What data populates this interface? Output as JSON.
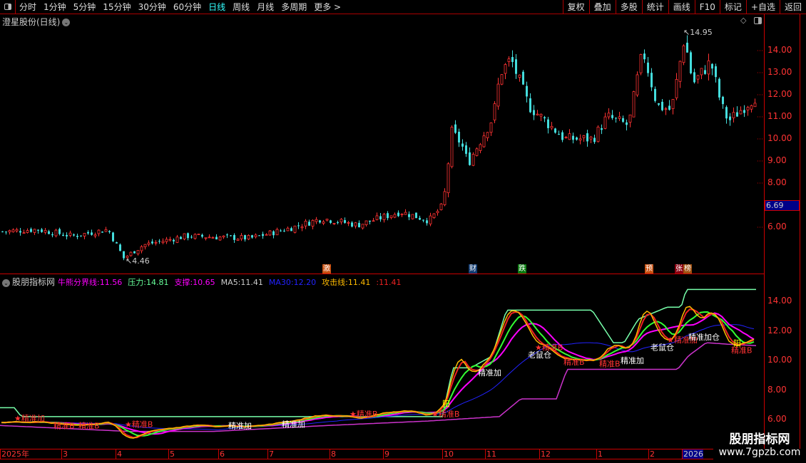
{
  "toolbar": {
    "tabs": [
      "分时",
      "1分钟",
      "5分钟",
      "15分钟",
      "30分钟",
      "60分钟",
      "日线",
      "周线",
      "月线",
      "多周期",
      "更多 >"
    ],
    "active": 6,
    "right": [
      "复权",
      "叠加",
      "多股",
      "统计",
      "画线",
      "F10",
      "标记",
      "+自选",
      "返回"
    ]
  },
  "main": {
    "title": "澄星股份(日线)",
    "high_label": "14.95",
    "low_label": "4.46",
    "current_price": "6.69",
    "yticks": [
      "14.00",
      "13.00",
      "12.00",
      "11.00",
      "10.00",
      "9.00",
      "8.00",
      "6.00"
    ]
  },
  "news": [
    {
      "t": "激",
      "c": "#c85010"
    },
    {
      "t": "财",
      "c": "#103a70"
    },
    {
      "t": "跌",
      "c": "#0a7a10"
    },
    {
      "t": "预",
      "c": "#c85010"
    },
    {
      "t": "张",
      "c": "#8a0010"
    },
    {
      "t": "榜",
      "c": "#a05010"
    }
  ],
  "indicator": {
    "name": "股朋指标网",
    "items": [
      {
        "label": "牛熊分界线:",
        "value": "11.56",
        "color": "#f0f"
      },
      {
        "label": "压力:",
        "value": "14.81",
        "color": "#6f9"
      },
      {
        "label": "支撑:",
        "value": "10.65",
        "color": "#f0f"
      },
      {
        "label": "MA5:",
        "value": "11.41",
        "color": "#ccc"
      },
      {
        "label": "MA30:",
        "value": "12.20",
        "color": "#22f"
      },
      {
        "label": "攻击线:",
        "value": "11.41",
        "color": "#fb0"
      },
      {
        "label": ":",
        "value": "11.41",
        "color": "#e22"
      }
    ],
    "yticks": [
      "14.00",
      "12.00",
      "10.00",
      "8.00",
      "6.00"
    ]
  },
  "dates": [
    "2025年",
    "3",
    "4",
    "5",
    "6",
    "7",
    "8",
    "9",
    "10",
    "11",
    "12",
    "1",
    "2",
    "2026"
  ],
  "watermark": {
    "title": "股朋指标网",
    "url": "www.7gpzb.com"
  },
  "chart_data": {
    "type": "candlestick",
    "anchors": [
      [
        0,
        5.8
      ],
      [
        50,
        5.9
      ],
      [
        100,
        5.6
      ],
      [
        150,
        5.9
      ],
      [
        172,
        4.6
      ],
      [
        200,
        5.2
      ],
      [
        260,
        5.6
      ],
      [
        350,
        5.5
      ],
      [
        410,
        6.0
      ],
      [
        450,
        6.4
      ],
      [
        500,
        6.1
      ],
      [
        560,
        6.7
      ],
      [
        600,
        6.3
      ],
      [
        620,
        7.0
      ],
      [
        632,
        10.3
      ],
      [
        645,
        9.8
      ],
      [
        655,
        8.9
      ],
      [
        690,
        11.0
      ],
      [
        700,
        13.0
      ],
      [
        715,
        13.6
      ],
      [
        740,
        11.5
      ],
      [
        790,
        10.0
      ],
      [
        830,
        10.0
      ],
      [
        850,
        11.0
      ],
      [
        880,
        10.6
      ],
      [
        890,
        12.4
      ],
      [
        900,
        14.0
      ],
      [
        920,
        11.5
      ],
      [
        940,
        11.3
      ],
      [
        958,
        14.6
      ],
      [
        970,
        12.5
      ],
      [
        995,
        13.5
      ],
      [
        1010,
        11.5
      ],
      [
        1020,
        10.8
      ],
      [
        1040,
        11.4
      ],
      [
        1060,
        12.0
      ]
    ],
    "pressure": [
      [
        0,
        6.8
      ],
      [
        20,
        6.8
      ],
      [
        30,
        6.2
      ],
      [
        620,
        6.2
      ],
      [
        635,
        9.5
      ],
      [
        660,
        9.5
      ],
      [
        690,
        10.3
      ],
      [
        710,
        13.4
      ],
      [
        830,
        13.4
      ],
      [
        860,
        11.2
      ],
      [
        875,
        11.2
      ],
      [
        895,
        12.8
      ],
      [
        935,
        13.6
      ],
      [
        955,
        13.6
      ],
      [
        962,
        14.8
      ],
      [
        1060,
        14.8
      ]
    ],
    "support": [
      [
        0,
        5.6
      ],
      [
        180,
        5.2
      ],
      [
        300,
        5.2
      ],
      [
        460,
        5.6
      ],
      [
        600,
        5.9
      ],
      [
        700,
        6.2
      ],
      [
        730,
        7.4
      ],
      [
        780,
        7.4
      ],
      [
        795,
        9.4
      ],
      [
        950,
        9.4
      ],
      [
        965,
        10.3
      ],
      [
        990,
        11.2
      ],
      [
        1020,
        11.1
      ],
      [
        1060,
        11.0
      ]
    ],
    "markers": [
      {
        "x": 20,
        "p": 5.9,
        "t": "★精准加"
      },
      {
        "x": 75,
        "p": 5.4,
        "t": "精准B"
      },
      {
        "x": 110,
        "p": 5.4,
        "t": "精准B"
      },
      {
        "x": 175,
        "p": 5.5,
        "t": "★精准B"
      },
      {
        "x": 320,
        "p": 5.4,
        "t": "精准加"
      },
      {
        "x": 395,
        "p": 5.5,
        "t": "精准加"
      },
      {
        "x": 490,
        "p": 6.2,
        "t": "★精准B"
      },
      {
        "x": 605,
        "p": 6.2,
        "t": "★精准B"
      },
      {
        "x": 620,
        "p": 6.9,
        "t": "阳"
      },
      {
        "x": 670,
        "p": 9.0,
        "t": "精准加"
      },
      {
        "x": 740,
        "p": 10.2,
        "t": "老鼠仓"
      },
      {
        "x": 750,
        "p": 10.7,
        "t": "★精准B"
      },
      {
        "x": 790,
        "p": 9.7,
        "t": "精准B"
      },
      {
        "x": 840,
        "p": 9.6,
        "t": "精准B"
      },
      {
        "x": 870,
        "p": 9.8,
        "t": "精准加"
      },
      {
        "x": 912,
        "p": 10.7,
        "t": "老鼠仓"
      },
      {
        "x": 935,
        "p": 11.2,
        "t": "★精准加"
      },
      {
        "x": 965,
        "p": 11.4,
        "t": "精准加仓"
      },
      {
        "x": 1025,
        "p": 10.5,
        "t": "精准B"
      },
      {
        "x": 1028,
        "p": 11.0,
        "t": "阳"
      }
    ]
  }
}
